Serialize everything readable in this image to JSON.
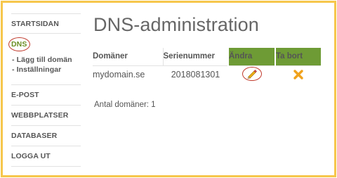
{
  "sidebar": {
    "items": [
      {
        "label": "STARTSIDAN"
      },
      {
        "label": "DNS"
      },
      {
        "label": "E-POST"
      },
      {
        "label": "WEBBPLATSER"
      },
      {
        "label": "DATABASER"
      },
      {
        "label": "LOGGA UT"
      }
    ],
    "dns_sub": [
      "- Lägg till domän",
      "- Inställningar"
    ],
    "active": "DNS"
  },
  "main": {
    "title": "DNS-administration",
    "columns": {
      "domain": "Domäner",
      "serial": "Serienummer",
      "edit": "Ändra",
      "delete": "Ta bort"
    },
    "rows": [
      {
        "domain": "mydomain.se",
        "serial": "2018081301",
        "edit_icon": "pencil-icon",
        "delete_icon": "cross-icon"
      }
    ],
    "count_text": "Antal domäner: 1"
  },
  "colors": {
    "border_frame": "#f6c64b",
    "header_green": "#6e9b35",
    "active_green": "#6b8e23",
    "highlight_red": "#c0392b",
    "delete_orange": "#f0a21c"
  }
}
